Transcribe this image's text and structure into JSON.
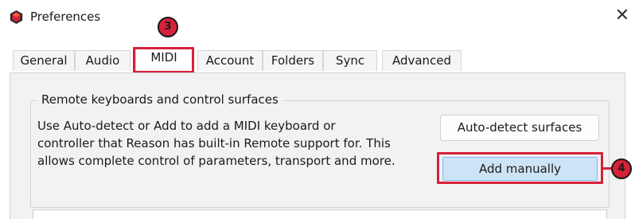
{
  "window": {
    "title": "Preferences",
    "close_glyph": "✕"
  },
  "tabs": [
    {
      "label": "General"
    },
    {
      "label": "Audio"
    },
    {
      "label": "MIDI"
    },
    {
      "label": "Account"
    },
    {
      "label": "Folders"
    },
    {
      "label": "Sync"
    },
    {
      "label": "Advanced"
    }
  ],
  "active_tab": "MIDI",
  "remote_group": {
    "label": "Remote keyboards and control surfaces",
    "description_line1": "Use Auto-detect or Add to add a MIDI keyboard or",
    "description_line2": "controller that Reason has built-in Remote support for. This",
    "description_line3": "allows complete control of parameters, transport and more.",
    "auto_detect_label": "Auto-detect surfaces",
    "add_manually_label": "Add manually"
  },
  "annotations": {
    "step_tab": "3",
    "step_button": "4",
    "color": "#d6213a"
  },
  "icons": {
    "app": "reason-app-icon",
    "close": "close-icon"
  }
}
